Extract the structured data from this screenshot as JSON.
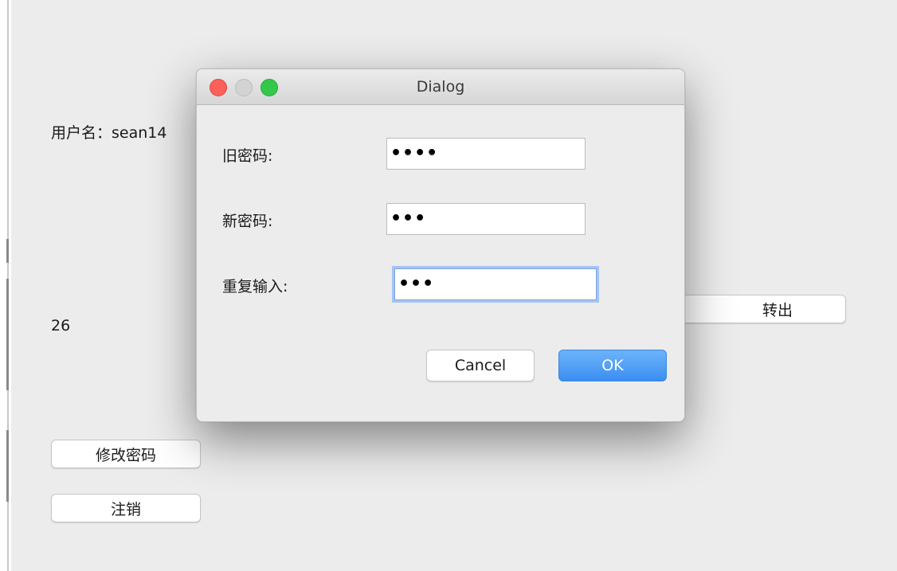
{
  "main_window": {
    "username_label": "用户名：sean14",
    "balance_value": "26",
    "transfer_out_button": "转出",
    "change_password_button": "修改密码",
    "logout_button": "注销"
  },
  "dialog": {
    "title": "Dialog",
    "old_password_label": "旧密码:",
    "old_password_value": "••••",
    "new_password_label": "新密码:",
    "new_password_value": "•••",
    "repeat_label": "重复输入:",
    "repeat_value": "•••",
    "cancel_button": "Cancel",
    "ok_button": "OK"
  },
  "colors": {
    "ok_button": "#3b8ef2",
    "close_light": "#fc605b",
    "minimize_light_inactive": "#d3d3d3",
    "zoom_light": "#34c84a",
    "focus_ring": "#a6c4f0"
  }
}
